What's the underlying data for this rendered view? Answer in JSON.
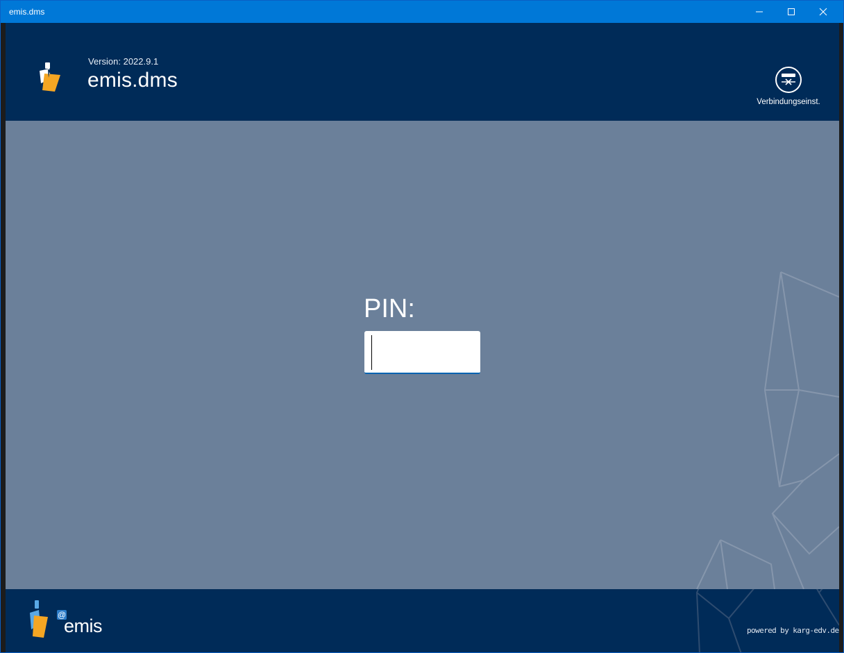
{
  "window": {
    "title": "emis.dms",
    "controls": {
      "minimize_icon": "minimize-icon",
      "maximize_icon": "maximize-icon",
      "close_icon": "close-icon"
    }
  },
  "header": {
    "version": "Version: 2022.9.1",
    "app_name": "emis.dms",
    "connection_button": {
      "label": "Verbindungseinst.",
      "icon": "connection-settings-icon"
    }
  },
  "login": {
    "pin_label": "PIN:",
    "pin_value": ""
  },
  "footer": {
    "brand_at": "@",
    "brand_name": "emis",
    "powered_by": "powered by karg-edv.de"
  },
  "colors": {
    "titlebar": "#0078d7",
    "header_bg": "#002b58",
    "main_bg": "#6b809a",
    "accent_orange": "#f5a623",
    "accent_blue": "#5aa9e6",
    "input_underline": "#0063b1"
  }
}
